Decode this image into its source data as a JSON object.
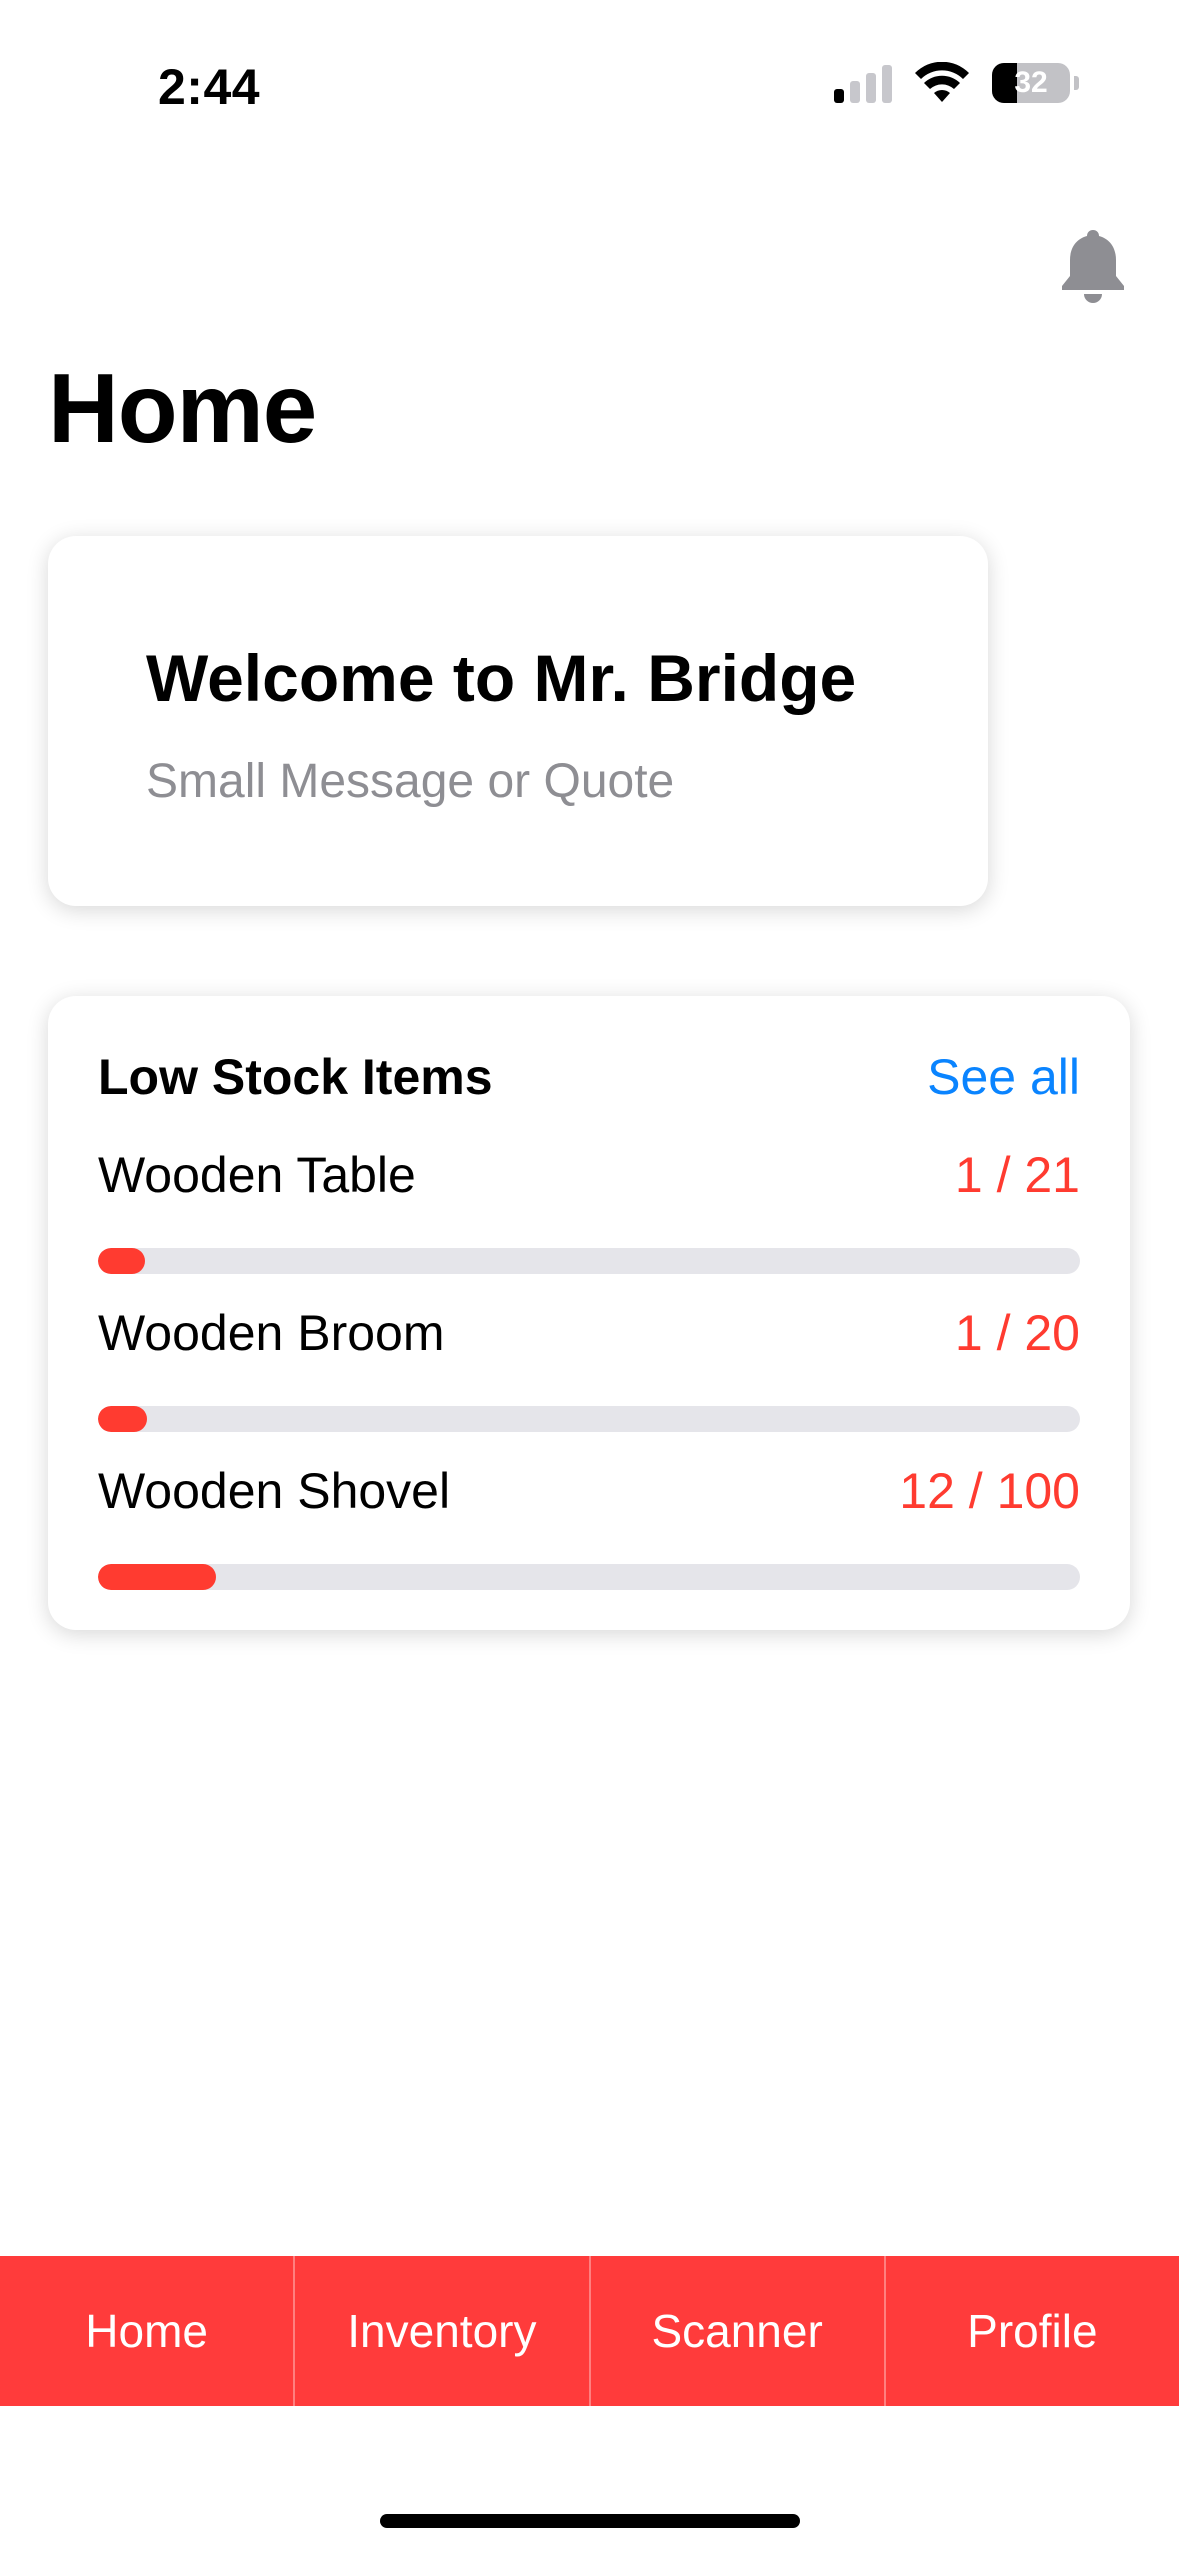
{
  "status_bar": {
    "time": "2:44",
    "battery_level": "32",
    "battery_percent": 32,
    "signal_bars_active": 1,
    "signal_bars_total": 4
  },
  "header": {
    "title": "Home",
    "notification_icon": "bell-icon"
  },
  "welcome": {
    "title": "Welcome to Mr. Bridge",
    "subtitle": "Small Message or Quote"
  },
  "low_stock": {
    "title": "Low Stock Items",
    "see_all_label": "See all",
    "items": [
      {
        "name": "Wooden Table",
        "qty_text": "1 / 21",
        "current": 1,
        "total": 21
      },
      {
        "name": "Wooden Broom",
        "qty_text": "1 / 20",
        "current": 1,
        "total": 20
      },
      {
        "name": "Wooden Shovel",
        "qty_text": "12 / 100",
        "current": 12,
        "total": 100
      }
    ]
  },
  "tab_bar": {
    "tabs": [
      {
        "label": "Home"
      },
      {
        "label": "Inventory"
      },
      {
        "label": "Scanner"
      },
      {
        "label": "Profile"
      }
    ]
  },
  "colors": {
    "accent": "#ff3b3b",
    "link": "#0a84ff",
    "warning_text": "#ff3b30",
    "track": "#e5e5ea"
  }
}
